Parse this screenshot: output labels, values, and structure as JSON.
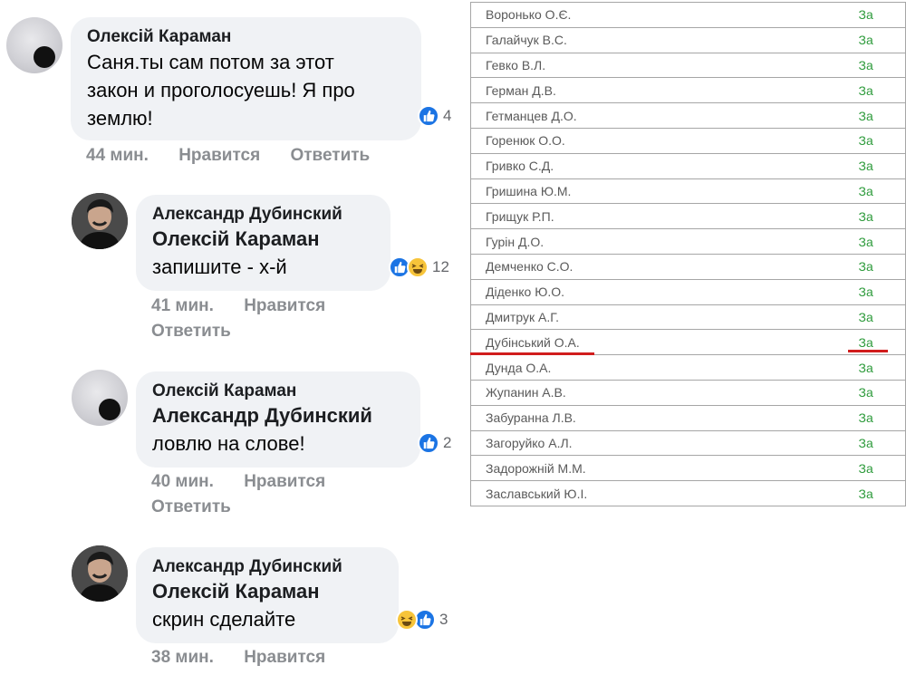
{
  "comments": [
    {
      "author": "Олексій Караман",
      "text_lines": [
        "Саня.ты сам потом за этот",
        "закон и проголосуешь! Я про",
        "землю!"
      ],
      "reaction_count": "4",
      "time": "44 мин.",
      "like": "Нравится",
      "reply": "Ответить"
    },
    {
      "author": "Александр Дубинский",
      "mention": "Олексій Караман",
      "text": "запишите - х-й",
      "reaction_count": "12",
      "time": "41 мин.",
      "like": "Нравится",
      "reply": "Ответить"
    },
    {
      "author": "Олексій Караман",
      "mention": "Александр Дубинский",
      "text": "ловлю на слове!",
      "reaction_count": "2",
      "time": "40 мин.",
      "like": "Нравится",
      "reply": "Ответить"
    },
    {
      "author": "Александр Дубинский",
      "mention": "Олексій Караман",
      "text": "скрин сделайте",
      "reaction_count": "3",
      "time": "38 мин.",
      "like": "Нравится"
    }
  ],
  "votes": [
    {
      "name": "Воронько О.Є.",
      "result": "За"
    },
    {
      "name": "Галайчук В.С.",
      "result": "За"
    },
    {
      "name": "Гевко В.Л.",
      "result": "За"
    },
    {
      "name": "Герман Д.В.",
      "result": "За"
    },
    {
      "name": "Гетманцев Д.О.",
      "result": "За"
    },
    {
      "name": "Горенюк О.О.",
      "result": "За"
    },
    {
      "name": "Гривко С.Д.",
      "result": "За"
    },
    {
      "name": "Гришина Ю.М.",
      "result": "За"
    },
    {
      "name": "Грищук Р.П.",
      "result": "За"
    },
    {
      "name": "Гурін Д.О.",
      "result": "За"
    },
    {
      "name": "Демченко С.О.",
      "result": "За"
    },
    {
      "name": "Діденко Ю.О.",
      "result": "За"
    },
    {
      "name": "Дмитрук А.Г.",
      "result": "За"
    },
    {
      "name": "Дубінський О.А.",
      "result": "За"
    },
    {
      "name": "Дунда О.А.",
      "result": "За"
    },
    {
      "name": "Жупанин А.В.",
      "result": "За"
    },
    {
      "name": "Забуранна Л.В.",
      "result": "За"
    },
    {
      "name": "Загоруйко А.Л.",
      "result": "За"
    },
    {
      "name": "Задорожній М.М.",
      "result": "За"
    },
    {
      "name": "Заславський Ю.І.",
      "result": "За"
    }
  ],
  "highlighted_vote_index": 13,
  "colors": {
    "like_blue": "#1b74e4",
    "vote_green": "#2e9b3c",
    "underline_red": "#d11d1d",
    "bubble_bg": "#f0f2f5"
  },
  "icons": [
    "like-reaction-icon",
    "haha-reaction-icon"
  ]
}
